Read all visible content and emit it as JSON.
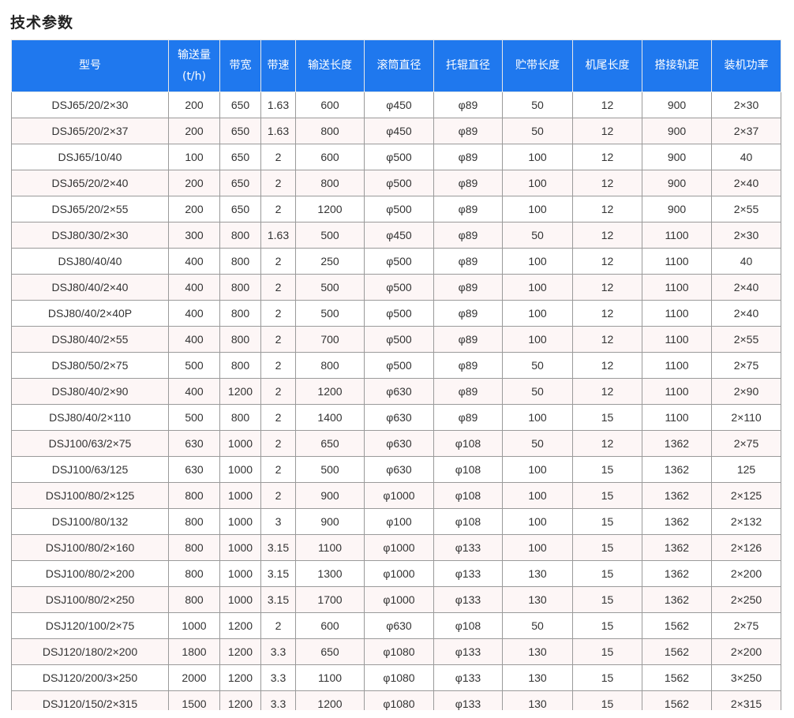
{
  "page": {
    "title": "技术参数"
  },
  "table": {
    "headers": [
      "型号",
      "输送量\n(t/h)",
      "带宽",
      "带速",
      "输送长度",
      "滚筒直径",
      "托辊直径",
      "贮带长度",
      "机尾长度",
      "搭接轨距",
      "装机功率"
    ],
    "rows": [
      [
        "DSJ65/20/2×30",
        "200",
        "650",
        "1.63",
        "600",
        "φ450",
        "φ89",
        "50",
        "12",
        "900",
        "2×30"
      ],
      [
        "DSJ65/20/2×37",
        "200",
        "650",
        "1.63",
        "800",
        "φ450",
        "φ89",
        "50",
        "12",
        "900",
        "2×37"
      ],
      [
        "DSJ65/10/40",
        "100",
        "650",
        "2",
        "600",
        "φ500",
        "φ89",
        "100",
        "12",
        "900",
        "40"
      ],
      [
        "DSJ65/20/2×40",
        "200",
        "650",
        "2",
        "800",
        "φ500",
        "φ89",
        "100",
        "12",
        "900",
        "2×40"
      ],
      [
        "DSJ65/20/2×55",
        "200",
        "650",
        "2",
        "1200",
        "φ500",
        "φ89",
        "100",
        "12",
        "900",
        "2×55"
      ],
      [
        "DSJ80/30/2×30",
        "300",
        "800",
        "1.63",
        "500",
        "φ450",
        "φ89",
        "50",
        "12",
        "1100",
        "2×30"
      ],
      [
        "DSJ80/40/40",
        "400",
        "800",
        "2",
        "250",
        "φ500",
        "φ89",
        "100",
        "12",
        "1100",
        "40"
      ],
      [
        "DSJ80/40/2×40",
        "400",
        "800",
        "2",
        "500",
        "φ500",
        "φ89",
        "100",
        "12",
        "1100",
        "2×40"
      ],
      [
        "DSJ80/40/2×40P",
        "400",
        "800",
        "2",
        "500",
        "φ500",
        "φ89",
        "100",
        "12",
        "1100",
        "2×40"
      ],
      [
        "DSJ80/40/2×55",
        "400",
        "800",
        "2",
        "700",
        "φ500",
        "φ89",
        "100",
        "12",
        "1100",
        "2×55"
      ],
      [
        "DSJ80/50/2×75",
        "500",
        "800",
        "2",
        "800",
        "φ500",
        "φ89",
        "50",
        "12",
        "1100",
        "2×75"
      ],
      [
        "DSJ80/40/2×90",
        "400",
        "1200",
        "2",
        "1200",
        "φ630",
        "φ89",
        "50",
        "12",
        "1100",
        "2×90"
      ],
      [
        "DSJ80/40/2×110",
        "500",
        "800",
        "2",
        "1400",
        "φ630",
        "φ89",
        "100",
        "15",
        "1100",
        "2×110"
      ],
      [
        "DSJ100/63/2×75",
        "630",
        "1000",
        "2",
        "650",
        "φ630",
        "φ108",
        "50",
        "12",
        "1362",
        "2×75"
      ],
      [
        "DSJ100/63/125",
        "630",
        "1000",
        "2",
        "500",
        "φ630",
        "φ108",
        "100",
        "15",
        "1362",
        "125"
      ],
      [
        "DSJ100/80/2×125",
        "800",
        "1000",
        "2",
        "900",
        "φ1000",
        "φ108",
        "100",
        "15",
        "1362",
        "2×125"
      ],
      [
        "DSJ100/80/132",
        "800",
        "1000",
        "3",
        "900",
        "φ100",
        "φ108",
        "100",
        "15",
        "1362",
        "2×132"
      ],
      [
        "DSJ100/80/2×160",
        "800",
        "1000",
        "3.15",
        "1100",
        "φ1000",
        "φ133",
        "100",
        "15",
        "1362",
        "2×126"
      ],
      [
        "DSJ100/80/2×200",
        "800",
        "1000",
        "3.15",
        "1300",
        "φ1000",
        "φ133",
        "130",
        "15",
        "1362",
        "2×200"
      ],
      [
        "DSJ100/80/2×250",
        "800",
        "1000",
        "3.15",
        "1700",
        "φ1000",
        "φ133",
        "130",
        "15",
        "1362",
        "2×250"
      ],
      [
        "DSJ120/100/2×75",
        "1000",
        "1200",
        "2",
        "600",
        "φ630",
        "φ108",
        "50",
        "15",
        "1562",
        "2×75"
      ],
      [
        "DSJ120/180/2×200",
        "1800",
        "1200",
        "3.3",
        "650",
        "φ1080",
        "φ133",
        "130",
        "15",
        "1562",
        "2×200"
      ],
      [
        "DSJ120/200/3×250",
        "2000",
        "1200",
        "3.3",
        "1100",
        "φ1080",
        "φ133",
        "130",
        "15",
        "1562",
        "3×250"
      ],
      [
        "DSJ120/150/2×315",
        "1500",
        "1200",
        "3.3",
        "1200",
        "φ1080",
        "φ133",
        "130",
        "15",
        "1562",
        "2×315"
      ]
    ]
  }
}
